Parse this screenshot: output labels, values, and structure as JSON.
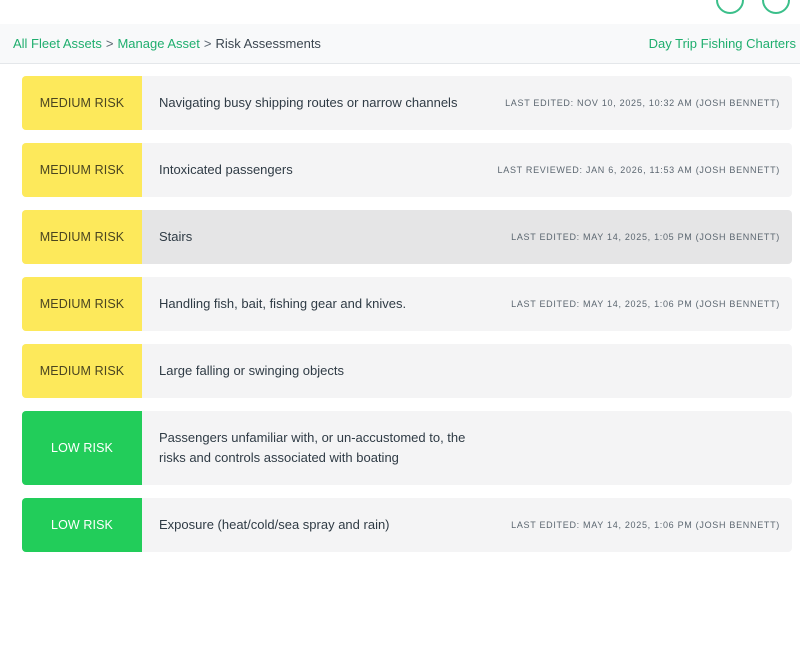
{
  "breadcrumb": {
    "items": [
      "All Fleet Assets",
      "Manage Asset"
    ],
    "separator": ">",
    "current": "Risk Assessments"
  },
  "header": {
    "company": "Day Trip Fishing Charters"
  },
  "colors": {
    "accent": "#1fae6e",
    "medium": "#fde95b",
    "low": "#22cd5a"
  },
  "risks": [
    {
      "level": "MEDIUM RISK",
      "title": "Navigating busy shipping routes or narrow channels",
      "meta": "LAST EDITED: NOV 10, 2025, 10:32 AM (JOSH BENNETT)"
    },
    {
      "level": "MEDIUM RISK",
      "title": "Intoxicated passengers",
      "meta": "LAST REVIEWED: JAN 6, 2026, 11:53 AM (JOSH BENNETT)"
    },
    {
      "level": "MEDIUM RISK",
      "title": "Stairs",
      "meta": "LAST EDITED: MAY 14, 2025, 1:05 PM (JOSH BENNETT)"
    },
    {
      "level": "MEDIUM RISK",
      "title": "Handling fish, bait, fishing gear and knives.",
      "meta": "LAST EDITED: MAY 14, 2025, 1:06 PM (JOSH BENNETT)"
    },
    {
      "level": "MEDIUM RISK",
      "title": "Large falling or swinging objects",
      "meta": ""
    },
    {
      "level": "LOW RISK",
      "title": "Passengers unfamiliar with, or un-accustomed to, the risks and controls associated with boating",
      "meta": ""
    },
    {
      "level": "LOW RISK",
      "title": "Exposure (heat/cold/sea spray and rain)",
      "meta": "LAST EDITED: MAY 14, 2025, 1:06 PM (JOSH BENNETT)"
    }
  ]
}
